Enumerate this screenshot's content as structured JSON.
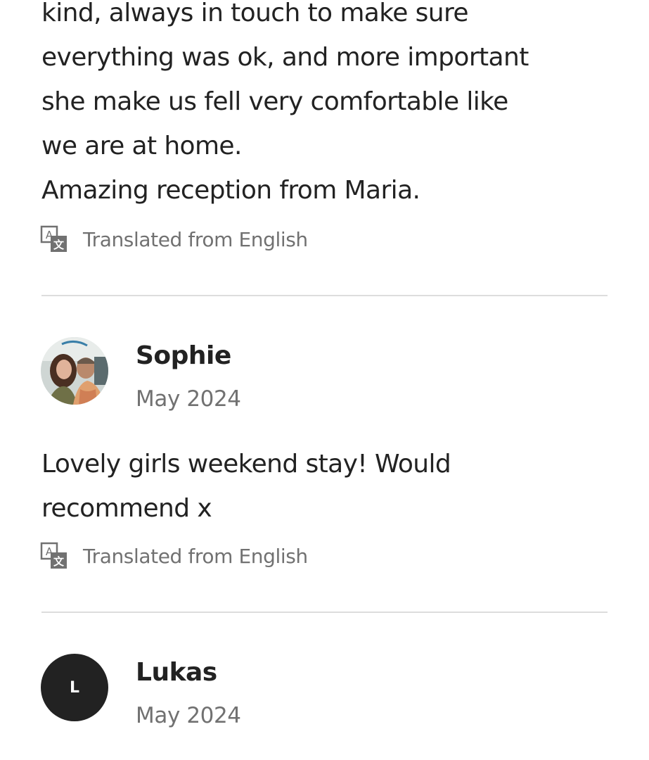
{
  "reviews": [
    {
      "text_lines": [
        "kind, always in touch to make sure",
        "everything was ok, and more important",
        "she make us  fell very comfortable  like",
        "we are at home.",
        "Amazing reception from Maria."
      ],
      "translation_note": "Translated from English"
    },
    {
      "name": "Sophie",
      "date": "May 2024",
      "text_lines": [
        "Lovely girls weekend stay! Would",
        "recommend x"
      ],
      "translation_note": "Translated from English"
    },
    {
      "name": "Lukas",
      "date": "May 2024",
      "avatar_initial": "L"
    }
  ],
  "icons": {
    "translate": "translate-icon",
    "avatar_photo": "avatar-photo"
  },
  "colors": {
    "text": "#222222",
    "muted": "#717171",
    "divider": "#dddddd",
    "avatar_bg": "#222222"
  }
}
